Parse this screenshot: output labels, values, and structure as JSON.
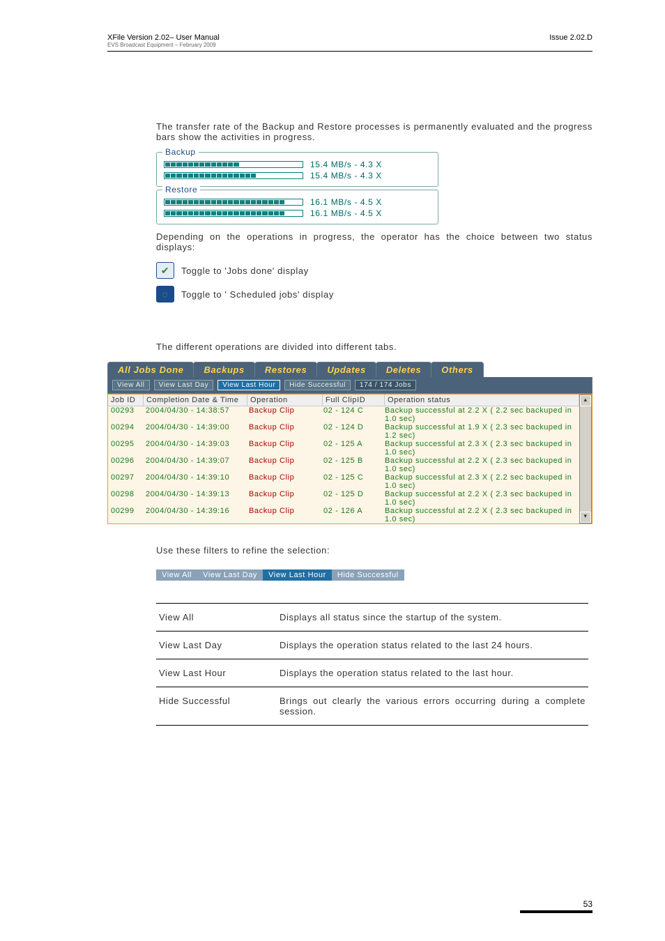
{
  "header": {
    "title_left": "XFile Version 2.02– User Manual",
    "subtitle_left": "EVS Broadcast Equipment – February 2009",
    "title_right": "Issue 2.02.D"
  },
  "intro_para": "The transfer rate of the Backup and Restore processes is permanently evaluated and the progress bars show the activities in progress.",
  "backup": {
    "legend": "Backup",
    "rate1": "15.4 MB/s - 4.3 X",
    "rate2": "15.4 MB/s - 4.3 X"
  },
  "restore": {
    "legend": "Restore",
    "rate1": "16.1 MB/s - 4.5 X",
    "rate2": "16.1 MB/s - 4.5 X"
  },
  "depending_para": "Depending on the operations in progress, the operator has the choice between two status displays:",
  "toggle_done": "Toggle to 'Jobs done' display",
  "toggle_scheduled": "Toggle to ' Scheduled jobs' display",
  "tabs_para": "The different operations are divided into different tabs.",
  "tabs": {
    "t1": "All Jobs Done",
    "t2": "Backups",
    "t3": "Restores",
    "t4": "Updates",
    "t5": "Deletes",
    "t6": "Others"
  },
  "filters": {
    "f1": "View All",
    "f2": "View Last Day",
    "f3": "View Last Hour",
    "f4": "Hide Successful",
    "count": "174 / 174 Jobs"
  },
  "grid": {
    "h_id": "Job ID",
    "h_date": "Completion Date & Time",
    "h_op": "Operation",
    "h_clip": "Full ClipID",
    "h_stat": "Operation status",
    "rows": [
      {
        "id": "00293",
        "date": "2004/04/30 - 14:38:57",
        "op": "Backup Clip",
        "clip": "02 - 124 C",
        "stat": "Backup successful at 2.2 X ( 2.2 sec backuped in 1.0 sec)"
      },
      {
        "id": "00294",
        "date": "2004/04/30 - 14:39:00",
        "op": "Backup Clip",
        "clip": "02 - 124 D",
        "stat": "Backup successful at 1.9 X ( 2.3 sec backuped in 1.2 sec)"
      },
      {
        "id": "00295",
        "date": "2004/04/30 - 14:39:03",
        "op": "Backup Clip",
        "clip": "02 - 125 A",
        "stat": "Backup successful at 2.3 X ( 2.3 sec backuped in 1.0 sec)"
      },
      {
        "id": "00296",
        "date": "2004/04/30 - 14:39:07",
        "op": "Backup Clip",
        "clip": "02 - 125 B",
        "stat": "Backup successful at 2.2 X ( 2.3 sec backuped in 1.0 sec)"
      },
      {
        "id": "00297",
        "date": "2004/04/30 - 14:39:10",
        "op": "Backup Clip",
        "clip": "02 - 125 C",
        "stat": "Backup successful at 2.3 X ( 2.2 sec backuped in 1.0 sec)"
      },
      {
        "id": "00298",
        "date": "2004/04/30 - 14:39:13",
        "op": "Backup Clip",
        "clip": "02 - 125 D",
        "stat": "Backup successful at 2.2 X ( 2.3 sec backuped in 1.0 sec)"
      },
      {
        "id": "00299",
        "date": "2004/04/30 - 14:39:16",
        "op": "Backup Clip",
        "clip": "02 - 126 A",
        "stat": "Backup successful at 2.2 X ( 2.3 sec backuped in 1.0 sec)"
      }
    ]
  },
  "refine_para": "Use these filters to refine the selection:",
  "filters2": {
    "f1": "View All",
    "f2": "View Last Day",
    "f3": "View Last Hour",
    "f4": "Hide Successful"
  },
  "desc": {
    "r1k": "View All",
    "r1v": "Displays all status since the startup of the system.",
    "r2k": "View Last Day",
    "r2v": "Displays the operation status related to the last 24 hours.",
    "r3k": "View Last Hour",
    "r3v": "Displays the operation status related to the last hour.",
    "r4k": "Hide Successful",
    "r4v": "Brings out clearly the various errors occurring during a complete session."
  },
  "page_number": "53"
}
